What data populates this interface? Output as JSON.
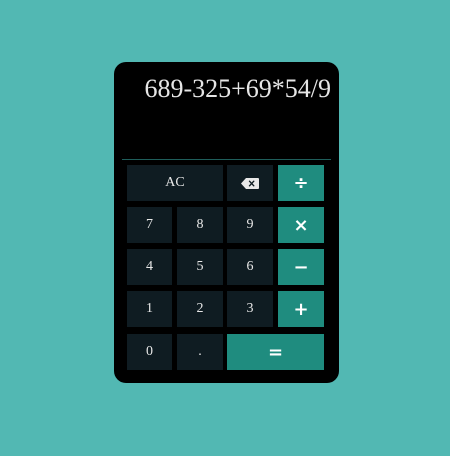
{
  "display": {
    "expression": "689-325+69*54/9"
  },
  "keys": {
    "clear": "AC",
    "backspace_icon": "backspace-icon",
    "divide": "÷",
    "seven": "7",
    "eight": "8",
    "nine": "9",
    "multiply": "×",
    "four": "4",
    "five": "5",
    "six": "6",
    "subtract": "−",
    "one": "1",
    "two": "2",
    "three": "3",
    "add": "+",
    "zero": "0",
    "decimal": ".",
    "equals": "="
  },
  "colors": {
    "page_background": "#52b8b3",
    "calculator_body": "#000000",
    "number_key": "#0f1c22",
    "operator_key": "#1f8c7f",
    "text": "#e8e8e8"
  }
}
